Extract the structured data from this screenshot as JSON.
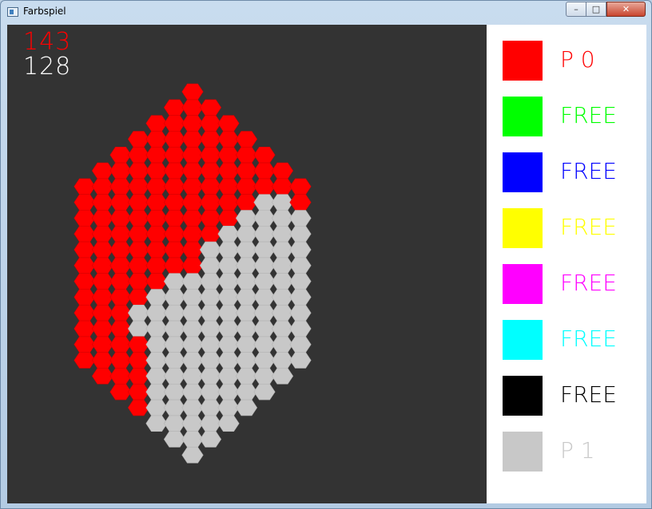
{
  "window": {
    "title": "Farbspiel",
    "min_glyph": "–",
    "max_glyph": "□",
    "close_glyph": "✕"
  },
  "scores": [
    {
      "value": "143",
      "color": "#ff0000"
    },
    {
      "value": "128",
      "color": "#ffffff"
    }
  ],
  "board": {
    "background": "#333333",
    "owned_color": "#ff0000",
    "owned_dark_edge": "#d60000",
    "opponent_color": "#c8c8c8",
    "opponent_dark_edge": "#b4b4b4",
    "owner_map": [
      "      0      ",
      "     000     ",
      "    00000    ",
      "   0000000   ",
      "  000000000  ",
      " 00000000000 ",
      "0000000000000",
      "0000000000110",
      "0000000001111",
      "0000000011111",
      "0000000111111",
      "0000000111111",
      "0000011111111",
      "0000111111111",
      "0001111111111",
      "0001111111111",
      "0000111111111",
      "0000111111111",
      " 00011111111 ",
      "  001111111  ",
      "   0111111   ",
      "    11111    ",
      "     111     ",
      "      1      "
    ]
  },
  "palette": [
    {
      "name": "red",
      "color": "#ff0000",
      "label": "P 0",
      "label_color": "#ff0000"
    },
    {
      "name": "green",
      "color": "#00ff00",
      "label": "FREE",
      "label_color": "#00ff00"
    },
    {
      "name": "blue",
      "color": "#0000ff",
      "label": "FREE",
      "label_color": "#0000ff"
    },
    {
      "name": "yellow",
      "color": "#ffff00",
      "label": "FREE",
      "label_color": "#ffff00"
    },
    {
      "name": "magenta",
      "color": "#ff00ff",
      "label": "FREE",
      "label_color": "#ff00ff"
    },
    {
      "name": "cyan",
      "color": "#00ffff",
      "label": "FREE",
      "label_color": "#00ffff"
    },
    {
      "name": "black",
      "color": "#000000",
      "label": "FREE",
      "label_color": "#000000"
    },
    {
      "name": "gray",
      "color": "#c8c8c8",
      "label": "P 1",
      "label_color": "#c8c8c8"
    }
  ]
}
